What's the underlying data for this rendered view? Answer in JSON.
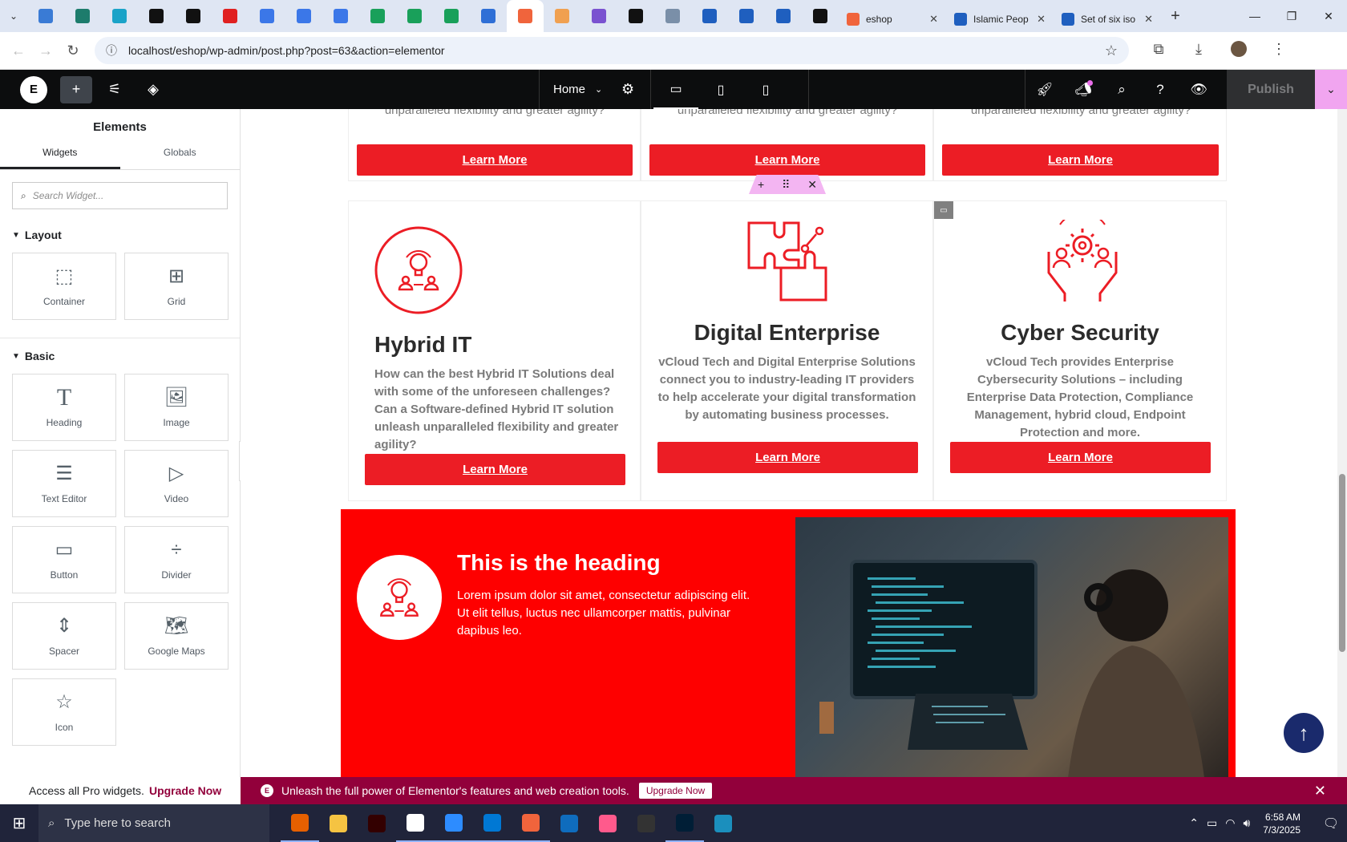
{
  "browser": {
    "tabs": [
      {
        "title": "eshop",
        "color": "#f0643c"
      },
      {
        "title": "Islamic Peop",
        "color": "#1f5fbf"
      },
      {
        "title": "Set of six iso",
        "color": "#1f5fbf"
      }
    ],
    "pinned_colors": [
      "#3a7bd5",
      "#1d7c6c",
      "#1aa3c8",
      "#111111",
      "#111111",
      "#e02020",
      "#3b77e8",
      "#3b77e8",
      "#3b77e8",
      "#19a05a",
      "#19a05a",
      "#19a05a",
      "#2f6fd6",
      "#f0643c",
      "#f0a050",
      "#7a52d0",
      "#111111",
      "#7a8fa8",
      "#1f5fbf",
      "#1f5fbf",
      "#1f5fbf",
      "#111111"
    ],
    "url": "localhost/eshop/wp-admin/post.php?post=63&action=elementor"
  },
  "elementor_bar": {
    "logo": "E",
    "page_label": "Home",
    "publish_label": "Publish"
  },
  "panel": {
    "title": "Elements",
    "tabs": [
      "Widgets",
      "Globals"
    ],
    "search_placeholder": "Search Widget...",
    "layout_label": "Layout",
    "layout_widgets": [
      {
        "label": "Container",
        "icon": "container-icon"
      },
      {
        "label": "Grid",
        "icon": "grid-icon"
      }
    ],
    "basic_label": "Basic",
    "basic_widgets": [
      {
        "label": "Heading",
        "icon": "heading-icon"
      },
      {
        "label": "Image",
        "icon": "image-icon"
      },
      {
        "label": "Text Editor",
        "icon": "text-editor-icon"
      },
      {
        "label": "Video",
        "icon": "video-icon"
      },
      {
        "label": "Button",
        "icon": "button-icon"
      },
      {
        "label": "Divider",
        "icon": "divider-icon"
      },
      {
        "label": "Spacer",
        "icon": "spacer-icon"
      },
      {
        "label": "Google Maps",
        "icon": "google-maps-icon"
      },
      {
        "label": "Icon",
        "icon": "icon-icon"
      }
    ],
    "promo_text": "Access all Pro widgets.",
    "promo_link": "Upgrade Now"
  },
  "canvas": {
    "top_cut_text": "unparalleled flexibility and greater agility?",
    "button_label": "Learn More",
    "cards": [
      {
        "title": "Hybrid IT",
        "text": "How can the best Hybrid IT Solutions deal with some of the unforeseen challenges? Can a Software-defined Hybrid IT solution unleash unparalleled flexibility and greater agility?"
      },
      {
        "title": "Digital Enterprise",
        "text": "vCloud Tech and Digital Enterprise Solutions connect you to industry-leading IT providers to help accelerate your digital transformation by automating business processes."
      },
      {
        "title": "Cyber Security",
        "text": "vCloud Tech provides Enterprise Cybersecurity Solutions – including Enterprise Data Protection, Compliance Management, hybrid cloud, Endpoint Protection and more."
      }
    ],
    "section": {
      "heading": "This is the heading",
      "text": "Lorem ipsum dolor sit amet, consectetur adipiscing elit. Ut elit tellus, luctus nec ullamcorper mattis, pulvinar dapibus leo."
    },
    "accent": "#ec1d25"
  },
  "notice": {
    "text": "Unleash the full power of Elementor's features and web creation tools.",
    "button": "Upgrade Now"
  },
  "taskbar": {
    "search_placeholder": "Type here to search",
    "time": "6:58 AM",
    "date": "7/3/2025",
    "app_colors": [
      "#e66000",
      "#f5c342",
      "#330000",
      "#ffffff",
      "#2d8cff",
      "#0078d4",
      "#f0643c",
      "#0f6cbd",
      "#ff5a8c",
      "#333333",
      "#001e36",
      "#1b8fbd"
    ]
  }
}
